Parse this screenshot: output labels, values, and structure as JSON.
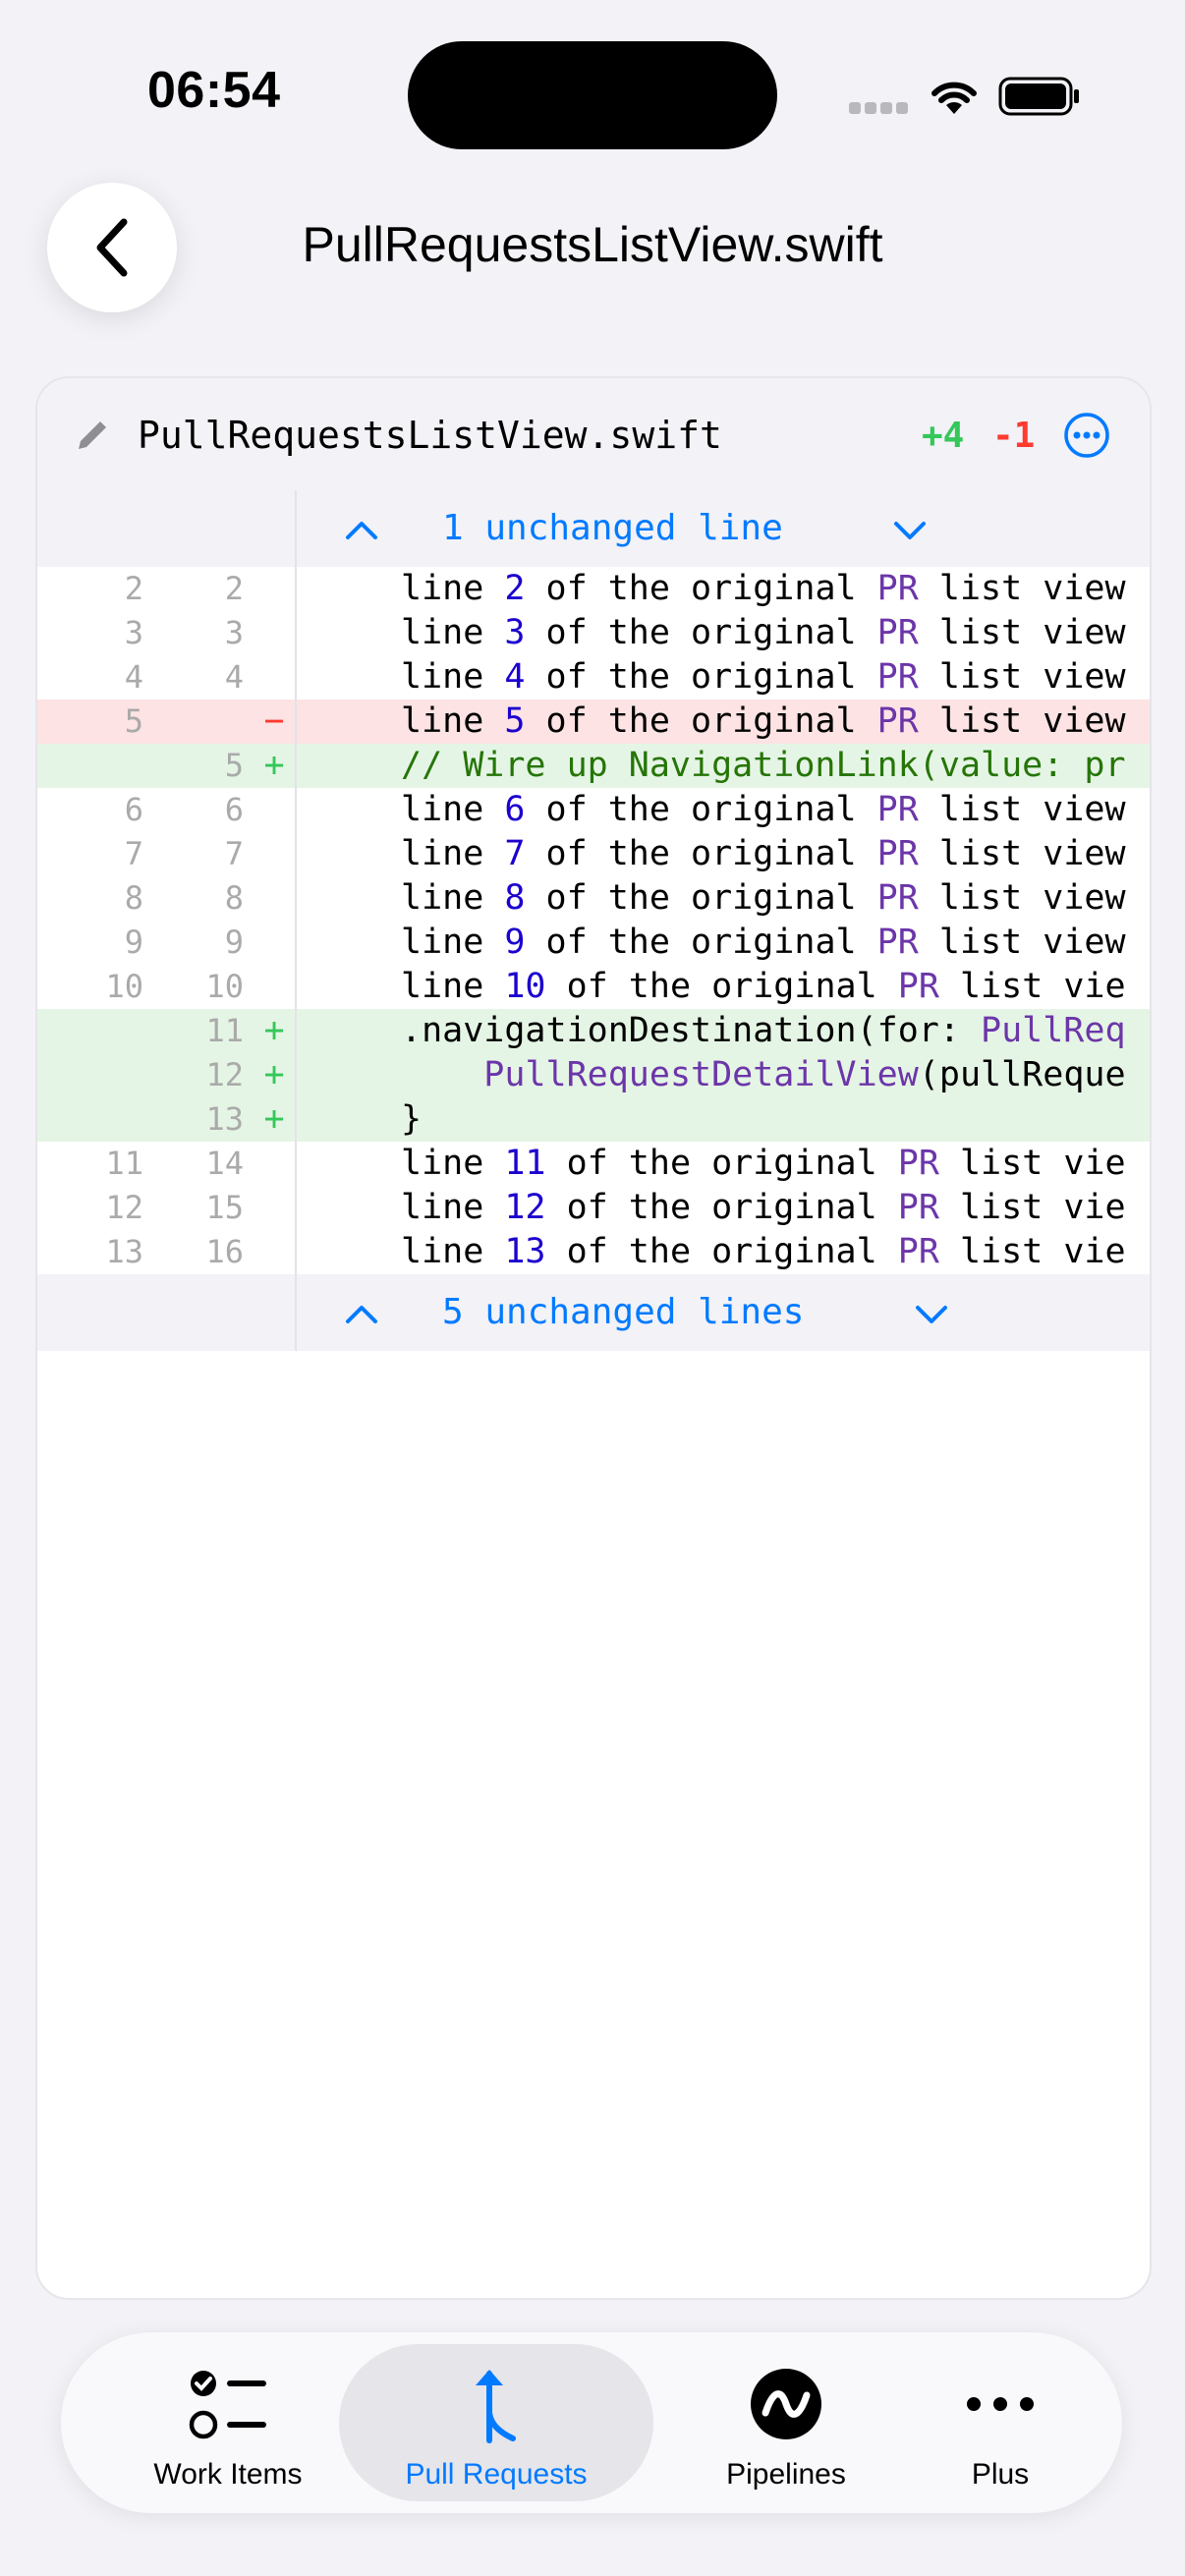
{
  "status_bar": {
    "time": "06:54"
  },
  "header": {
    "title": "PullRequestsListView.swift"
  },
  "file": {
    "name": "PullRequestsListView.swift",
    "additions": "+4",
    "deletions": "-1",
    "collapsed_top": "1 unchanged line",
    "collapsed_bottom": "5 unchanged lines"
  },
  "rows": [
    {
      "type": "ctx",
      "old": "2",
      "new": "2",
      "marker": "",
      "parts": [
        [
          "line ",
          ""
        ],
        [
          "2",
          "num"
        ],
        [
          " of the original ",
          ""
        ],
        [
          "PR",
          "kw"
        ],
        [
          " list view",
          ""
        ]
      ]
    },
    {
      "type": "ctx",
      "old": "3",
      "new": "3",
      "marker": "",
      "parts": [
        [
          "line ",
          ""
        ],
        [
          "3",
          "num"
        ],
        [
          " of the original ",
          ""
        ],
        [
          "PR",
          "kw"
        ],
        [
          " list view",
          ""
        ]
      ]
    },
    {
      "type": "ctx",
      "old": "4",
      "new": "4",
      "marker": "",
      "parts": [
        [
          "line ",
          ""
        ],
        [
          "4",
          "num"
        ],
        [
          " of the original ",
          ""
        ],
        [
          "PR",
          "kw"
        ],
        [
          " list view",
          ""
        ]
      ]
    },
    {
      "type": "del",
      "old": "5",
      "new": "",
      "marker": "−",
      "parts": [
        [
          "line ",
          ""
        ],
        [
          "5",
          "num"
        ],
        [
          " of the original ",
          ""
        ],
        [
          "PR",
          "kw"
        ],
        [
          " list view",
          ""
        ]
      ]
    },
    {
      "type": "add",
      "old": "",
      "new": "5",
      "marker": "+",
      "parts": [
        [
          "// Wire up NavigationLink(value: pr",
          ""
        ]
      ],
      "cls": "cmt"
    },
    {
      "type": "ctx",
      "old": "6",
      "new": "6",
      "marker": "",
      "parts": [
        [
          "line ",
          ""
        ],
        [
          "6",
          "num"
        ],
        [
          " of the original ",
          ""
        ],
        [
          "PR",
          "kw"
        ],
        [
          " list view",
          ""
        ]
      ]
    },
    {
      "type": "ctx",
      "old": "7",
      "new": "7",
      "marker": "",
      "parts": [
        [
          "line ",
          ""
        ],
        [
          "7",
          "num"
        ],
        [
          " of the original ",
          ""
        ],
        [
          "PR",
          "kw"
        ],
        [
          " list view",
          ""
        ]
      ]
    },
    {
      "type": "ctx",
      "old": "8",
      "new": "8",
      "marker": "",
      "parts": [
        [
          "line ",
          ""
        ],
        [
          "8",
          "num"
        ],
        [
          " of the original ",
          ""
        ],
        [
          "PR",
          "kw"
        ],
        [
          " list view",
          ""
        ]
      ]
    },
    {
      "type": "ctx",
      "old": "9",
      "new": "9",
      "marker": "",
      "parts": [
        [
          "line ",
          ""
        ],
        [
          "9",
          "num"
        ],
        [
          " of the original ",
          ""
        ],
        [
          "PR",
          "kw"
        ],
        [
          " list view",
          ""
        ]
      ]
    },
    {
      "type": "ctx",
      "old": "10",
      "new": "10",
      "marker": "",
      "parts": [
        [
          "line ",
          ""
        ],
        [
          "10",
          "num"
        ],
        [
          " of the original ",
          ""
        ],
        [
          "PR",
          "kw"
        ],
        [
          " list vie",
          ""
        ]
      ]
    },
    {
      "type": "add",
      "old": "",
      "new": "11",
      "marker": "+",
      "parts": [
        [
          ".navigationDestination(for: ",
          ""
        ],
        [
          "PullReq",
          "kw"
        ]
      ]
    },
    {
      "type": "add",
      "old": "",
      "new": "12",
      "marker": "+",
      "parts": [
        [
          "    ",
          ""
        ],
        [
          "PullRequestDetailView",
          "kw"
        ],
        [
          "(pullReque",
          ""
        ]
      ]
    },
    {
      "type": "add",
      "old": "",
      "new": "13",
      "marker": "+",
      "parts": [
        [
          "}",
          ""
        ]
      ]
    },
    {
      "type": "ctx",
      "old": "11",
      "new": "14",
      "marker": "",
      "parts": [
        [
          "line ",
          ""
        ],
        [
          "11",
          "num"
        ],
        [
          " of the original ",
          ""
        ],
        [
          "PR",
          "kw"
        ],
        [
          " list vie",
          ""
        ]
      ]
    },
    {
      "type": "ctx",
      "old": "12",
      "new": "15",
      "marker": "",
      "parts": [
        [
          "line ",
          ""
        ],
        [
          "12",
          "num"
        ],
        [
          " of the original ",
          ""
        ],
        [
          "PR",
          "kw"
        ],
        [
          " list vie",
          ""
        ]
      ]
    },
    {
      "type": "ctx",
      "old": "13",
      "new": "16",
      "marker": "",
      "parts": [
        [
          "line ",
          ""
        ],
        [
          "13",
          "num"
        ],
        [
          " of the original ",
          ""
        ],
        [
          "PR",
          "kw"
        ],
        [
          " list vie",
          ""
        ]
      ]
    }
  ],
  "tabs": [
    {
      "label": "Work Items",
      "icon": "checklist-icon",
      "selected": false
    },
    {
      "label": "Pull Requests",
      "icon": "merge-arrow-icon",
      "selected": true
    },
    {
      "label": "Pipelines",
      "icon": "pipelines-icon",
      "selected": false
    },
    {
      "label": "Plus",
      "icon": "ellipsis-icon",
      "selected": false
    }
  ],
  "colors": {
    "accent": "#007aff",
    "added": "#34c759",
    "removed": "#ff3b30",
    "added_bg": "#e5f5e5",
    "removed_bg": "#fde3e3"
  }
}
